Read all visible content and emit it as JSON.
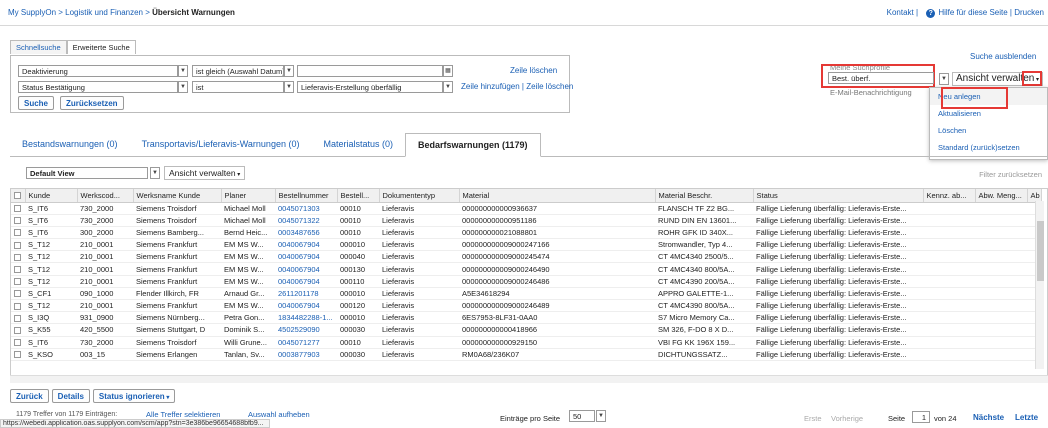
{
  "breadcrumb": {
    "root": "My SupplyOn",
    "sep": " > ",
    "section": "Logistik und Finanzen",
    "current": "Übersicht Warnungen"
  },
  "topright": {
    "contact": "Kontakt |",
    "help": "Hilfe für diese Seite | Drucken"
  },
  "search": {
    "tabs": [
      "Schnellsuche",
      "Erweiterte Suche"
    ],
    "row1": {
      "field": "Deaktivierung",
      "op": "ist gleich (Auswahl Datum)",
      "value": ""
    },
    "row2": {
      "field": "Status Bestätigung",
      "op": "ist",
      "value": "Lieferavis-Erstellung überfällig"
    },
    "delete_row": "Zeile löschen",
    "add_delete_row": "Zeile hinzufügen | Zeile löschen",
    "search_button": "Suche",
    "reset_button": "Zurücksetzen",
    "hide": "Suche ausblenden"
  },
  "profiles": {
    "label": "Meine Suchprofile",
    "selected": "Best. überf.",
    "email_label": "E-Mail-Benachrichtigung",
    "manage": "Ansicht verwalten",
    "menu": [
      "Neu anlegen",
      "Aktualisieren",
      "Löschen",
      "Standard (zurück)setzen"
    ]
  },
  "tabs": [
    "Bestandswarnungen (0)",
    "Transportavis/Lieferavis-Warnungen (0)",
    "Materialstatus (0)",
    "Bedarfswarnungen (1179)"
  ],
  "view": {
    "selected": "Default View",
    "manage": "Ansicht verwalten",
    "filter_reset": "Filter zurücksetzen"
  },
  "table": {
    "headers": [
      "Kunde",
      "Werkscod...",
      "Werksname Kunde",
      "Planer",
      "Bestellnummer",
      "Bestell...",
      "Dokumententyp",
      "Material",
      "Material Beschr.",
      "Status",
      "Kennz. ab...",
      "Abw. Meng...",
      "Ab"
    ],
    "rows": [
      [
        "S_IT6",
        "730_2000",
        "Siemens Troisdorf",
        "Michael Moll",
        "0045071303",
        "00010",
        "Lieferavis",
        "000000000000936637",
        "FLANSCH TF Z2 BG...",
        "Fällige Lieferung überfällig: Lieferavis-Erste..."
      ],
      [
        "S_IT6",
        "730_2000",
        "Siemens Troisdorf",
        "Michael Moll",
        "0045071322",
        "00010",
        "Lieferavis",
        "000000000000951186",
        "RUND DIN EN 13601...",
        "Fällige Lieferung überfällig: Lieferavis-Erste..."
      ],
      [
        "S_IT6",
        "300_2000",
        "Siemens Bamberg...",
        "Bernd Heic...",
        "0003487656",
        "00010",
        "Lieferavis",
        "000000000021088801",
        "ROHR GFK ID 340X...",
        "Fällige Lieferung überfällig: Lieferavis-Erste..."
      ],
      [
        "S_T12",
        "210_0001",
        "Siemens Frankfurt",
        "EM MS W...",
        "0040067904",
        "000010",
        "Lieferavis",
        "000000000009000247166",
        "Stromwandler, Typ 4...",
        "Fällige Lieferung überfällig: Lieferavis-Erste..."
      ],
      [
        "S_T12",
        "210_0001",
        "Siemens Frankfurt",
        "EM MS W...",
        "0040067904",
        "000040",
        "Lieferavis",
        "000000000009000245474",
        "CT 4MC4340 2500/5...",
        "Fällige Lieferung überfällig: Lieferavis-Erste..."
      ],
      [
        "S_T12",
        "210_0001",
        "Siemens Frankfurt",
        "EM MS W...",
        "0040067904",
        "000130",
        "Lieferavis",
        "000000000009000246490",
        "CT 4MC4340 800/5A...",
        "Fällige Lieferung überfällig: Lieferavis-Erste..."
      ],
      [
        "S_T12",
        "210_0001",
        "Siemens Frankfurt",
        "EM MS W...",
        "0040067904",
        "000110",
        "Lieferavis",
        "000000000009000246486",
        "CT 4MC4390 200/5A...",
        "Fällige Lieferung überfällig: Lieferavis-Erste..."
      ],
      [
        "S_CF1",
        "090_1000",
        "Flender Illkirch, FR",
        "Arnaud Gr...",
        "2611201178",
        "000010",
        "Lieferavis",
        "A5E34618294",
        "APPRO GALETTE-1...",
        "Fällige Lieferung überfällig: Lieferavis-Erste..."
      ],
      [
        "S_T12",
        "210_0001",
        "Siemens Frankfurt",
        "EM MS W...",
        "0040067904",
        "000120",
        "Lieferavis",
        "000000000009000246489",
        "CT 4MC4390 800/5A...",
        "Fällige Lieferung überfällig: Lieferavis-Erste..."
      ],
      [
        "S_I3Q",
        "931_0900",
        "Siemens Nürnberg...",
        "Petra Gon...",
        "1834482288-1...",
        "000010",
        "Lieferavis",
        "6ES7953-8LF31-0AA0",
        "S7 Micro Memory Ca...",
        "Fällige Lieferung überfällig: Lieferavis-Erste..."
      ],
      [
        "S_K55",
        "420_5500",
        "Siemens Stuttgart, D",
        "Dominik S...",
        "4502529090",
        "000030",
        "Lieferavis",
        "000000000000418966",
        "SM 326, F-DO 8 X D...",
        "Fällige Lieferung überfällig: Lieferavis-Erste..."
      ],
      [
        "S_IT6",
        "730_2000",
        "Siemens Troisdorf",
        "Willi Grune...",
        "0045071277",
        "00010",
        "Lieferavis",
        "000000000000929150",
        "VBI FG KK 196X 159...",
        "Fällige Lieferung überfällig: Lieferavis-Erste..."
      ],
      [
        "S_KSO",
        "003_15",
        "Siemens Erlangen",
        "Tanlan, Sv...",
        "0003877903",
        "000030",
        "Lieferavis",
        "RM0A68/236K07",
        "DICHTUNGSSATZ...",
        "Fällige Lieferung überfällig: Lieferavis-Erste..."
      ]
    ]
  },
  "footer": {
    "back": "Zurück",
    "details": "Details",
    "ignore": "Status ignorieren",
    "count": "1179 Treffer von 1179 Einträgen:",
    "select_all": "Alle Treffer selektieren",
    "deselect": "Auswahl aufheben",
    "per_page_label": "Einträge pro Seite",
    "per_page": "50",
    "first": "Erste",
    "prev": "Vorherige",
    "page_label": "Seite",
    "page": "1",
    "of": "von 24",
    "next": "Nächste",
    "last": "Letzte"
  },
  "statusbar": "https://webedi.application.oas.supplyon.com/scm/app?stn=3e386be96654688bfb9..."
}
